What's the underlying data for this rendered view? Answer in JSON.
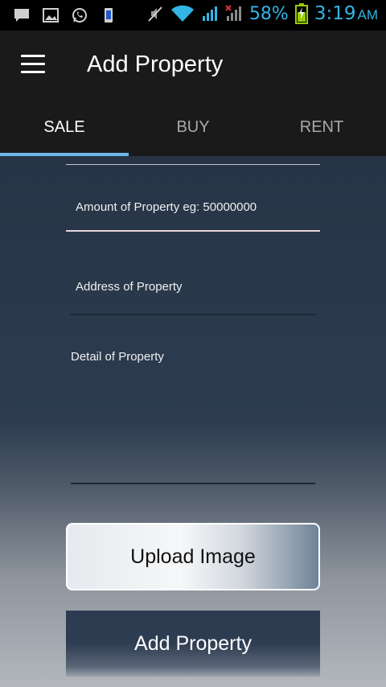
{
  "status_bar": {
    "battery_percent": "58%",
    "time": "3:19",
    "ampm": "AM",
    "icons": [
      "message-icon",
      "image-icon",
      "whatsapp-icon",
      "phone-icon",
      "mute-icon",
      "wifi-icon",
      "signal-icon",
      "signal-icon-2",
      "battery-charging-icon"
    ],
    "accent_color": "#33b5e5"
  },
  "app_bar": {
    "title": "Add Property",
    "menu_icon": "hamburger-menu-icon"
  },
  "tabs": [
    {
      "label": "SALE",
      "active": true
    },
    {
      "label": "BUY",
      "active": false
    },
    {
      "label": "RENT",
      "active": false
    }
  ],
  "form": {
    "amount": {
      "placeholder": "Amount of Property eg: 50000000",
      "value": ""
    },
    "address": {
      "placeholder": "Address of Property",
      "value": ""
    },
    "detail": {
      "placeholder": "Detail of Property",
      "value": ""
    }
  },
  "buttons": {
    "upload": "Upload Image",
    "add": "Add Property"
  },
  "colors": {
    "tab_indicator": "#6fb7e9",
    "app_bar_bg": "#1a1a1a",
    "content_top": "#263446"
  }
}
